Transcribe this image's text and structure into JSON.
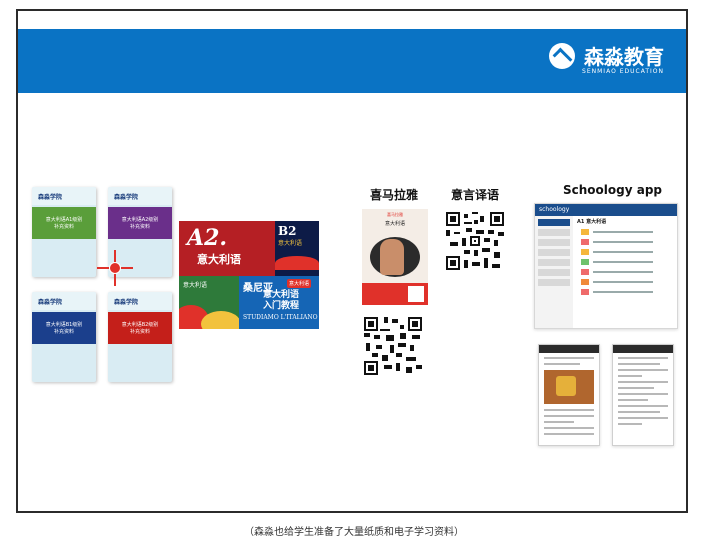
{
  "brand": {
    "name": "森淼教育",
    "sub": "SENMIAO EDUCATION"
  },
  "books": [
    {
      "title": "森淼学院",
      "band": "意大利语A1级别\n补充资料"
    },
    {
      "title": "森淼学院",
      "band": "意大利语A2级别\n补充资料"
    },
    {
      "title": "森淼学院",
      "band": "意大利语B1级别\n补充资料"
    },
    {
      "title": "森淼学院",
      "band": "意大利语B2级别\n补充资料"
    }
  ],
  "poster": {
    "a2_big": "A2.",
    "a2_cn": "意大利语",
    "b2_big": "B2",
    "b2_cn": "意大利语",
    "green_text": "意大利语",
    "blue_cn1": "桑尼亚",
    "blue_tag": "意大利语",
    "blue_cn2": "意大利语\n入门教程",
    "blue_it": "STUDIAMO L'ITALIANO"
  },
  "labels": {
    "ximalaya": "喜马拉雅",
    "yiyan": "意言译语",
    "schoology": "Schoology app"
  },
  "ximalaya_card": {
    "header": "喜马拉雅",
    "title": "意大利语"
  },
  "schoology_screen": {
    "nav": "schoology",
    "heading": "A1 意大利语"
  },
  "caption": "（森淼也给学生准备了大量纸质和电子学习资料）"
}
